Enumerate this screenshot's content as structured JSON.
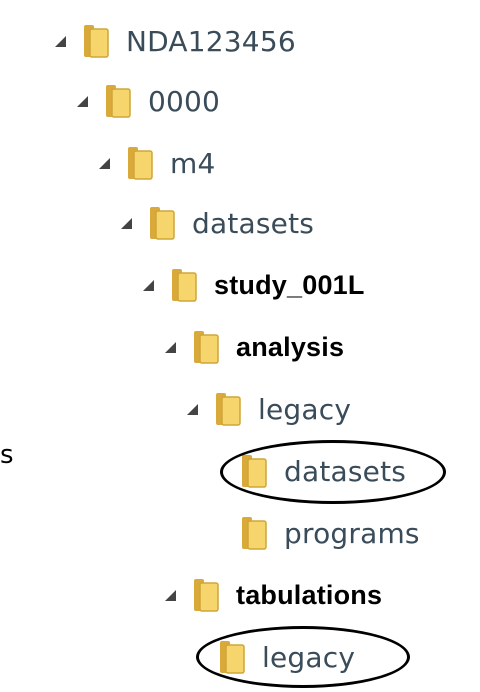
{
  "tree": {
    "items": [
      {
        "label": "NDA123456",
        "expanded": true,
        "bold": false
      },
      {
        "label": "0000",
        "expanded": true,
        "bold": false
      },
      {
        "label": "m4",
        "expanded": true,
        "bold": false
      },
      {
        "label": "datasets",
        "expanded": true,
        "bold": false
      },
      {
        "label": "study_001L",
        "expanded": true,
        "bold": true
      },
      {
        "label": "analysis",
        "expanded": true,
        "bold": true
      },
      {
        "label": "legacy",
        "expanded": true,
        "bold": false
      },
      {
        "label": "datasets",
        "expanded": false,
        "bold": false,
        "circled": true
      },
      {
        "label": "programs",
        "expanded": false,
        "bold": false
      },
      {
        "label": "tabulations",
        "expanded": true,
        "bold": true
      },
      {
        "label": "legacy",
        "expanded": false,
        "bold": false,
        "circled": true
      }
    ]
  },
  "edge_text": "s",
  "colors": {
    "folder_front": "#f6d66c",
    "folder_back": "#d9a93a",
    "arrow": "#444444",
    "label": "#3a4c5a"
  },
  "icons": {
    "expand": "expanded-arrow-icon",
    "folder": "folder-icon"
  }
}
